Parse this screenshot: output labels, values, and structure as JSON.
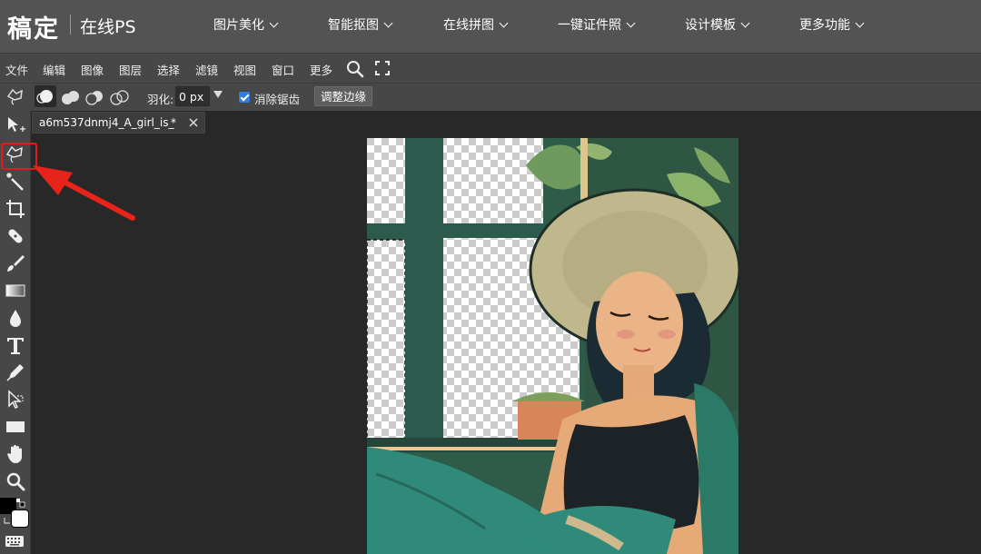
{
  "header": {
    "logo": "稿定",
    "subtitle": "在线PS",
    "nav": [
      "图片美化",
      "智能抠图",
      "在线拼图",
      "一键证件照",
      "设计模板",
      "更多功能"
    ]
  },
  "menubar": {
    "items": [
      "文件",
      "编辑",
      "图像",
      "图层",
      "选择",
      "滤镜",
      "视图",
      "窗口",
      "更多"
    ]
  },
  "options": {
    "feather_label": "羽化:",
    "feather_value": "0 px",
    "antialias_label": "消除锯齿",
    "antialias_checked": true,
    "refine_edge_label": "调整边缘"
  },
  "document": {
    "tab_title": "a6m537dnmj4_A_girl_is_",
    "modified_mark": "*"
  },
  "tools": [
    "move-tool-icon",
    "polygonal-lasso-tool-icon",
    "magic-wand-tool-icon",
    "crop-tool-icon",
    "healing-tool-icon",
    "brush-tool-icon",
    "gradient-tool-icon",
    "blur-tool-icon",
    "text-tool-icon",
    "pen-tool-icon",
    "path-select-tool-icon",
    "rectangle-tool-icon",
    "hand-tool-icon",
    "zoom-tool-icon"
  ],
  "colors": {
    "highlight": "#e01b1b",
    "accent_check": "#2f7de1",
    "foreground": "#000000",
    "background": "#ffffff"
  }
}
